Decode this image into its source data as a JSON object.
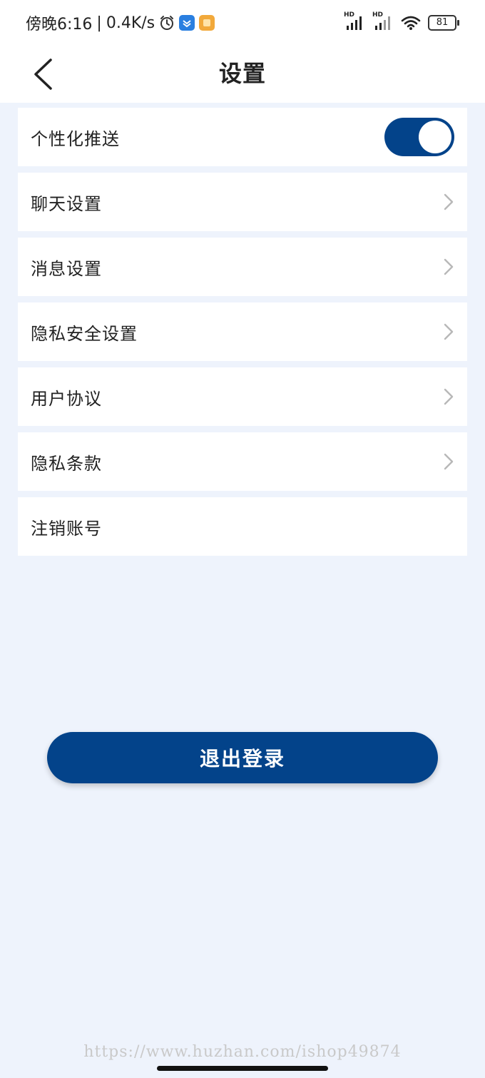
{
  "status_bar": {
    "time": "傍晚6:16",
    "separator": "|",
    "speed": "0.4K/s",
    "battery": "81",
    "signal_label_1": "HD",
    "signal_label_2": "HD"
  },
  "header": {
    "title": "设置"
  },
  "settings": {
    "items": [
      {
        "label": "个性化推送",
        "control": "toggle",
        "toggle_on": true
      },
      {
        "label": "聊天设置",
        "control": "chevron"
      },
      {
        "label": "消息设置",
        "control": "chevron"
      },
      {
        "label": "隐私安全设置",
        "control": "chevron"
      },
      {
        "label": "用户协议",
        "control": "chevron"
      },
      {
        "label": "隐私条款",
        "control": "chevron"
      },
      {
        "label": "注销账号",
        "control": "none"
      }
    ]
  },
  "logout": {
    "label": "退出登录"
  },
  "watermark": "https://www.huzhan.com/ishop49874",
  "colors": {
    "primary": "#03438a",
    "background": "#eef3fc",
    "card": "#ffffff",
    "chevron": "#b8b8b8"
  }
}
